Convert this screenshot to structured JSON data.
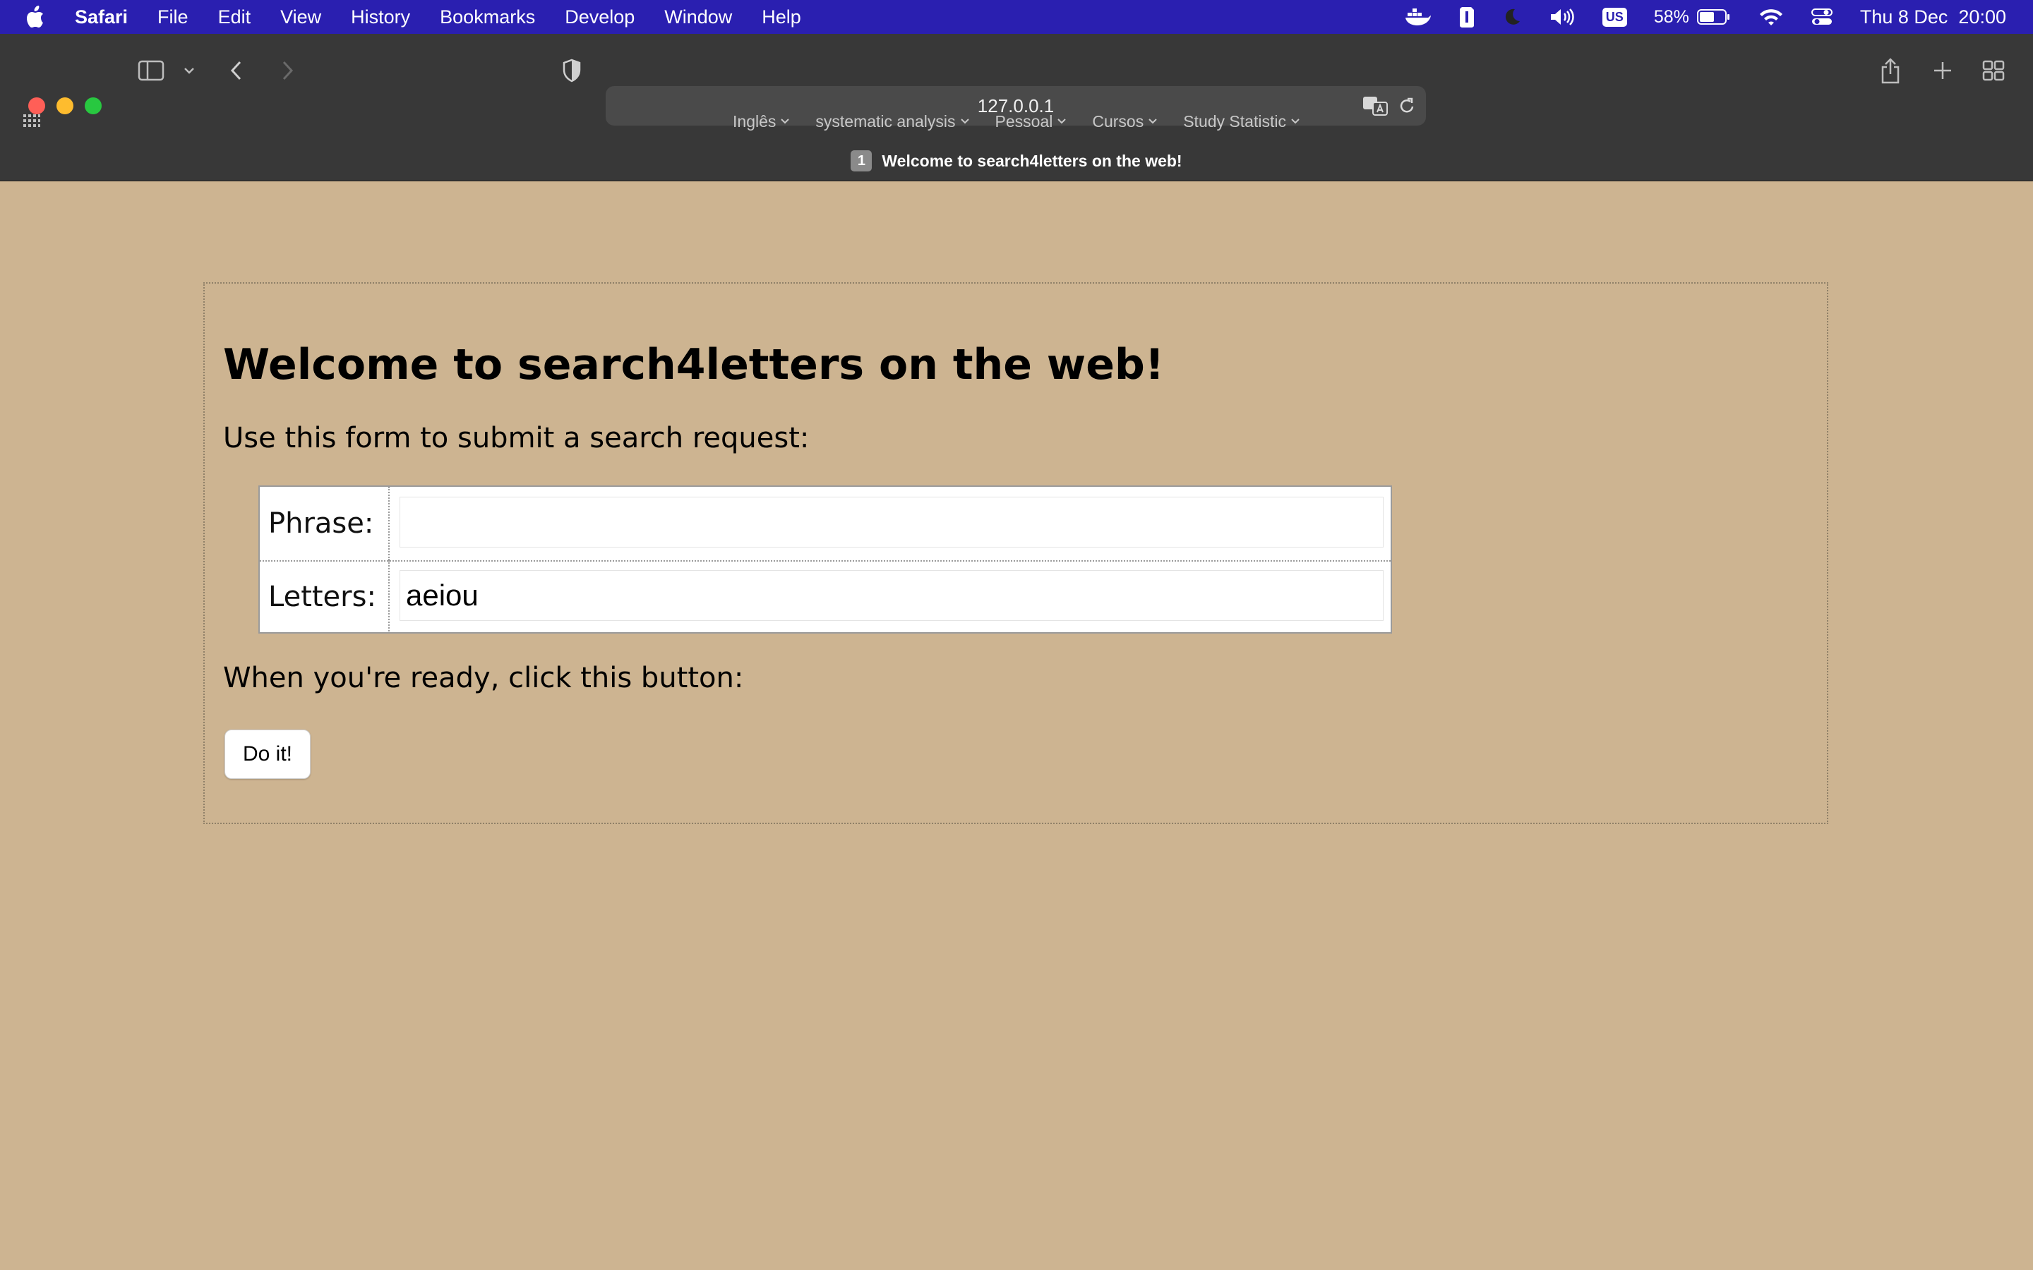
{
  "menubar": {
    "app_name": "Safari",
    "items": [
      "File",
      "Edit",
      "View",
      "History",
      "Bookmarks",
      "Develop",
      "Window",
      "Help"
    ],
    "status": {
      "battery": "58%",
      "keyboard": "US",
      "datetime": "Thu 8 Dec  20:00"
    },
    "icons": [
      "apple-logo-icon",
      "docker-icon",
      "evernote-icon",
      "moon-icon",
      "volume-icon",
      "battery-icon",
      "wifi-icon",
      "control-center-icon"
    ]
  },
  "browser": {
    "url": "127.0.0.1",
    "favorites": [
      {
        "label": "Inglês"
      },
      {
        "label": "systematic analysis"
      },
      {
        "label": "Pessoal"
      },
      {
        "label": "Cursos"
      },
      {
        "label": "Study Statistic"
      }
    ],
    "tab": {
      "number": "1",
      "title": "Welcome to search4letters on the web!"
    },
    "colors": {
      "menubar": "#2a1fb0",
      "toolbar": "#383838",
      "page_bg": "#cdb491"
    }
  },
  "page": {
    "title": "Welcome to search4letters on the web!",
    "intro": "Use this form to submit a search request:",
    "form": {
      "phrase_label": "Phrase:",
      "phrase_value": "",
      "letters_label": "Letters:",
      "letters_value": "aeiou"
    },
    "ready_text": "When you're ready, click this button:",
    "submit_label": "Do it!"
  }
}
